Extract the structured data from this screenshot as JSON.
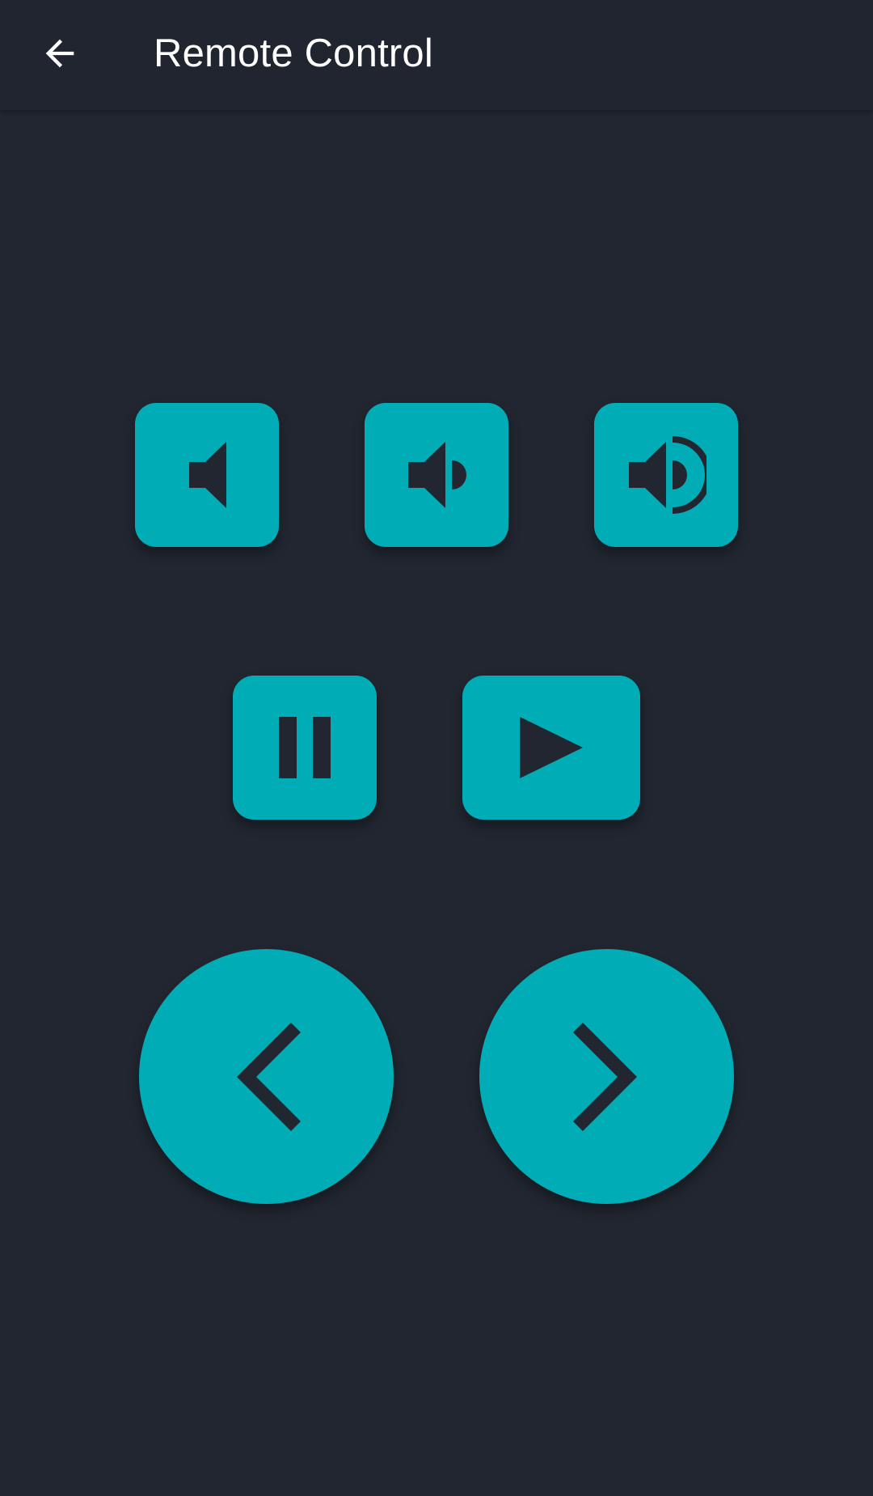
{
  "appbar": {
    "title": "Remote Control",
    "back_icon": "arrow-back-icon"
  },
  "colors": {
    "background": "#212630",
    "appbar": "#20252f",
    "accent": "#00acb5",
    "icon_dark": "#212630",
    "title_text": "#ffffff"
  },
  "controls": {
    "volume_mute_icon": "volume-mute-icon",
    "volume_down_icon": "volume-down-icon",
    "volume_up_icon": "volume-up-icon",
    "pause_icon": "pause-icon",
    "play_icon": "play-icon",
    "previous_icon": "chevron-left-icon",
    "next_icon": "chevron-right-icon"
  }
}
